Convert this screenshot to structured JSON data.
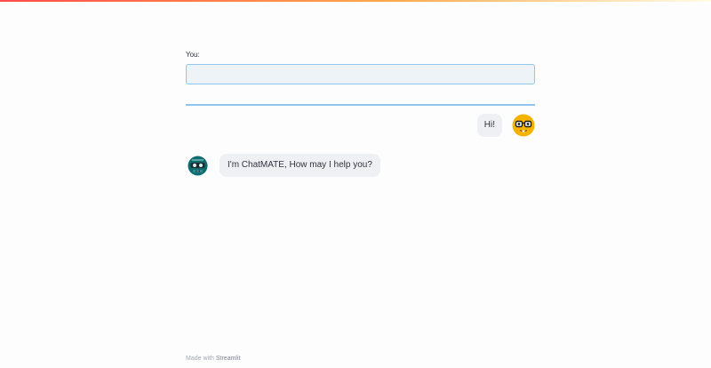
{
  "colors": {
    "accent": "#8fc6ee",
    "bubble": "#eef0f3",
    "bot_avatar": "#0e6b72",
    "user_avatar": "#f5b300"
  },
  "input": {
    "label": "You:",
    "value": "",
    "placeholder": ""
  },
  "messages": {
    "user": {
      "text": "Hi!",
      "avatar_icon": "nerd-face-emoji-icon"
    },
    "bot": {
      "text": "I'm ChatMATE, How may I help you?",
      "avatar_icon": "bot-avatar-icon"
    }
  },
  "footer": {
    "prefix": "Made with ",
    "brand": "Streamlit"
  }
}
